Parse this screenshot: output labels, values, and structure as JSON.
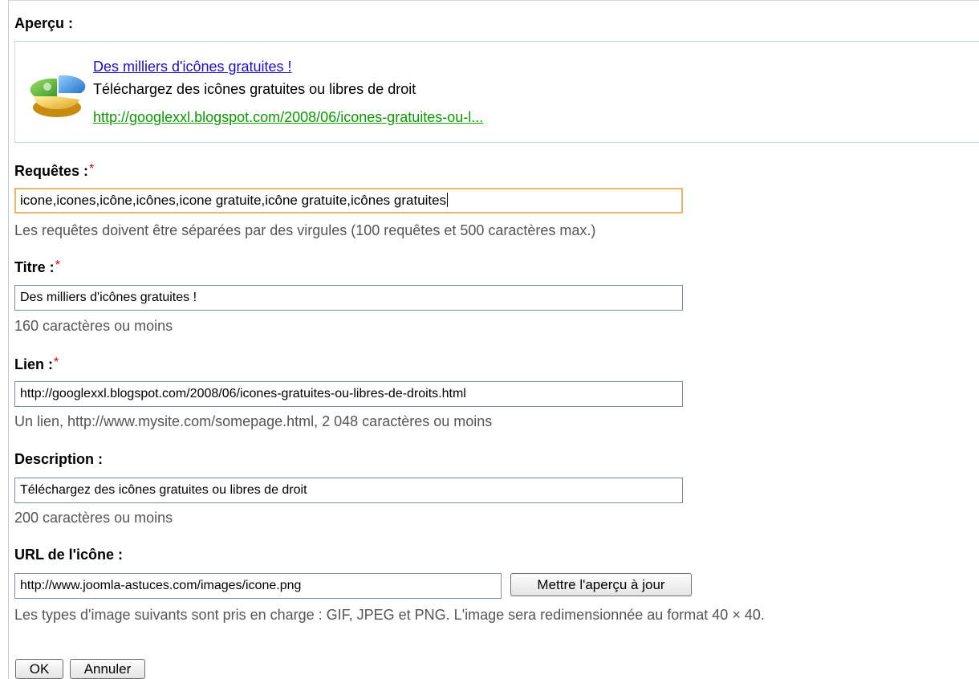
{
  "preview": {
    "label": "Aperçu :",
    "icon": "ad-icon",
    "title": "Des milliers d'icônes gratuites !",
    "description": "Téléchargez des icônes gratuites ou libres de droit",
    "url": "http://googlexxl.blogspot.com/2008/06/icones-gratuites-ou-l..."
  },
  "queries": {
    "label": "Requêtes :",
    "required_mark": "*",
    "value": "icone,icones,icône,icônes,icone gratuite,icône gratuite,icônes gratuites",
    "hint": "Les requêtes doivent être séparées par des virgules (100 requêtes et 500 caractères max.)"
  },
  "title_field": {
    "label": "Titre :",
    "required_mark": "*",
    "value": "Des milliers d'icônes gratuites !",
    "hint": "160 caractères ou moins"
  },
  "link_field": {
    "label": "Lien :",
    "required_mark": "*",
    "value": "http://googlexxl.blogspot.com/2008/06/icones-gratuites-ou-libres-de-droits.html",
    "hint": "Un lien, http://www.mysite.com/somepage.html, 2 048 caractères ou moins"
  },
  "description_field": {
    "label": "Description :",
    "value": "Téléchargez des icônes gratuites ou libres de droit",
    "hint": "200 caractères ou moins"
  },
  "icon_url_field": {
    "label": "URL de l'icône :",
    "value": "http://www.joomla-astuces.com/images/icone.png",
    "update_button": "Mettre l'aperçu à jour",
    "hint": "Les types d'image suivants sont pris en charge : GIF, JPEG et PNG. L'image sera redimensionnée au format 40 × 40."
  },
  "actions": {
    "ok": "OK",
    "cancel": "Annuler"
  },
  "colors": {
    "link": "#1a0dcc",
    "url": "#0a9a00",
    "required": "#d40000",
    "focus_border": "#e8b765",
    "hint_text": "#555555"
  }
}
